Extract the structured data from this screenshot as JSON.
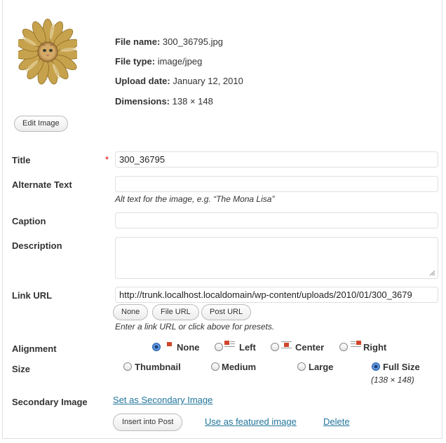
{
  "image_info": {
    "file_name_label": "File name:",
    "file_name": "300_36795.jpg",
    "file_type_label": "File type:",
    "file_type": "image/jpeg",
    "upload_date_label": "Upload date:",
    "upload_date": "January 12, 2010",
    "dimensions_label": "Dimensions:",
    "dimensions": "138 × 148",
    "edit_button": "Edit Image"
  },
  "fields": {
    "title": {
      "label": "Title",
      "required_mark": "*",
      "value": "300_36795"
    },
    "alt_text": {
      "label": "Alternate Text",
      "value": "",
      "help": "Alt text for the image, e.g. “The Mona Lisa”"
    },
    "caption": {
      "label": "Caption",
      "value": ""
    },
    "description": {
      "label": "Description",
      "value": ""
    },
    "link_url": {
      "label": "Link URL",
      "value": "http://trunk.localhost.localdomain/wp-content/uploads/2010/01/300_3679",
      "presets": [
        "None",
        "File URL",
        "Post URL"
      ],
      "help": "Enter a link URL or click above for presets."
    }
  },
  "alignment": {
    "label": "Alignment",
    "options": [
      "None",
      "Left",
      "Center",
      "Right"
    ],
    "selected": "None"
  },
  "size": {
    "label": "Size",
    "options": [
      "Thumbnail",
      "Medium",
      "Large",
      "Full Size"
    ],
    "selected": "Full Size",
    "full_size_dims": "(138 × 148)"
  },
  "secondary": {
    "label": "Secondary Image",
    "set_link": "Set as Secondary Image"
  },
  "actions": {
    "insert": "Insert into Post",
    "featured": "Use as featured image",
    "delete": "Delete"
  },
  "colors": {
    "link": "#21759b",
    "required": "#dd0000",
    "border": "#dfdfdf"
  }
}
